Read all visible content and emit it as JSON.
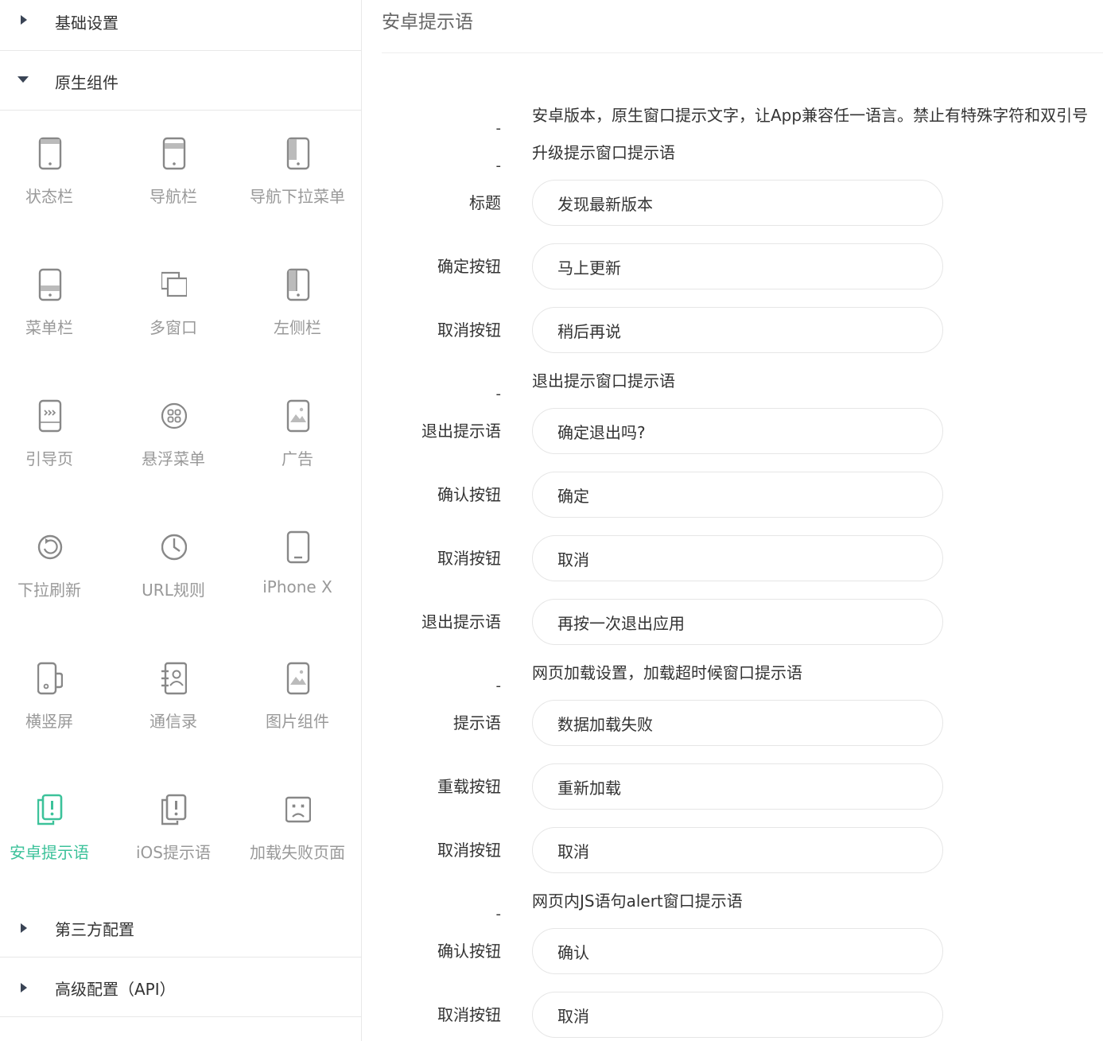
{
  "sidebar": {
    "sections": {
      "basic": {
        "label": "基础设置",
        "expanded": false
      },
      "native": {
        "label": "原生组件",
        "expanded": true
      },
      "thirdparty": {
        "label": "第三方配置",
        "expanded": false
      },
      "advanced": {
        "label": "高级配置（API）",
        "expanded": false
      }
    },
    "components": [
      {
        "label": "状态栏",
        "icon": "status-bar-icon"
      },
      {
        "label": "导航栏",
        "icon": "navigation-bar-icon"
      },
      {
        "label": "导航下拉菜单",
        "icon": "nav-dropdown-icon"
      },
      {
        "label": "菜单栏",
        "icon": "menu-bar-icon"
      },
      {
        "label": "多窗口",
        "icon": "multi-window-icon"
      },
      {
        "label": "左侧栏",
        "icon": "left-sidebar-icon"
      },
      {
        "label": "引导页",
        "icon": "guide-page-icon"
      },
      {
        "label": "悬浮菜单",
        "icon": "floating-menu-icon"
      },
      {
        "label": "广告",
        "icon": "advertisement-icon"
      },
      {
        "label": "下拉刷新",
        "icon": "pull-refresh-icon"
      },
      {
        "label": "URL规则",
        "icon": "url-rules-icon"
      },
      {
        "label": "iPhone X",
        "icon": "iphone-x-icon"
      },
      {
        "label": "横竖屏",
        "icon": "screen-orientation-icon"
      },
      {
        "label": "通信录",
        "icon": "contacts-icon"
      },
      {
        "label": "图片组件",
        "icon": "image-component-icon"
      },
      {
        "label": "安卓提示语",
        "icon": "android-prompt-icon",
        "active": true
      },
      {
        "label": "iOS提示语",
        "icon": "ios-prompt-icon"
      },
      {
        "label": "加载失败页面",
        "icon": "load-fail-page-icon"
      }
    ]
  },
  "main": {
    "title": "安卓提示语",
    "groups": {
      "intro": {
        "dash": "-",
        "text": "安卓版本，原生窗口提示文字，让App兼容任一语言。禁止有特殊字符和双引号"
      },
      "upgrade": {
        "dash": "-",
        "text": "升级提示窗口提示语"
      },
      "exit": {
        "dash": "-",
        "text": "退出提示窗口提示语"
      },
      "loading": {
        "dash": "-",
        "text": "网页加载设置，加载超时候窗口提示语"
      },
      "alert": {
        "dash": "-",
        "text": "网页内JS语句alert窗口提示语"
      }
    },
    "fields": {
      "upgrade_title": {
        "label": "标题",
        "value": "发现最新版本"
      },
      "upgrade_confirm": {
        "label": "确定按钮",
        "value": "马上更新"
      },
      "upgrade_cancel": {
        "label": "取消按钮",
        "value": "稍后再说"
      },
      "exit_prompt": {
        "label": "退出提示语",
        "value": "确定退出吗?"
      },
      "exit_confirm": {
        "label": "确认按钮",
        "value": "确定"
      },
      "exit_cancel": {
        "label": "取消按钮",
        "value": "取消"
      },
      "exit_toast": {
        "label": "退出提示语",
        "value": "再按一次退出应用"
      },
      "load_prompt": {
        "label": "提示语",
        "value": "数据加载失败"
      },
      "load_reload": {
        "label": "重载按钮",
        "value": "重新加载"
      },
      "load_cancel": {
        "label": "取消按钮",
        "value": "取消"
      },
      "alert_confirm": {
        "label": "确认按钮",
        "value": "确认"
      },
      "alert_cancel": {
        "label": "取消按钮",
        "value": "取消"
      }
    }
  },
  "colors": {
    "accent": "#3cc29a",
    "icon": "#888888",
    "label": "#999999",
    "border": "#e8e8e8",
    "text": "#333333"
  }
}
